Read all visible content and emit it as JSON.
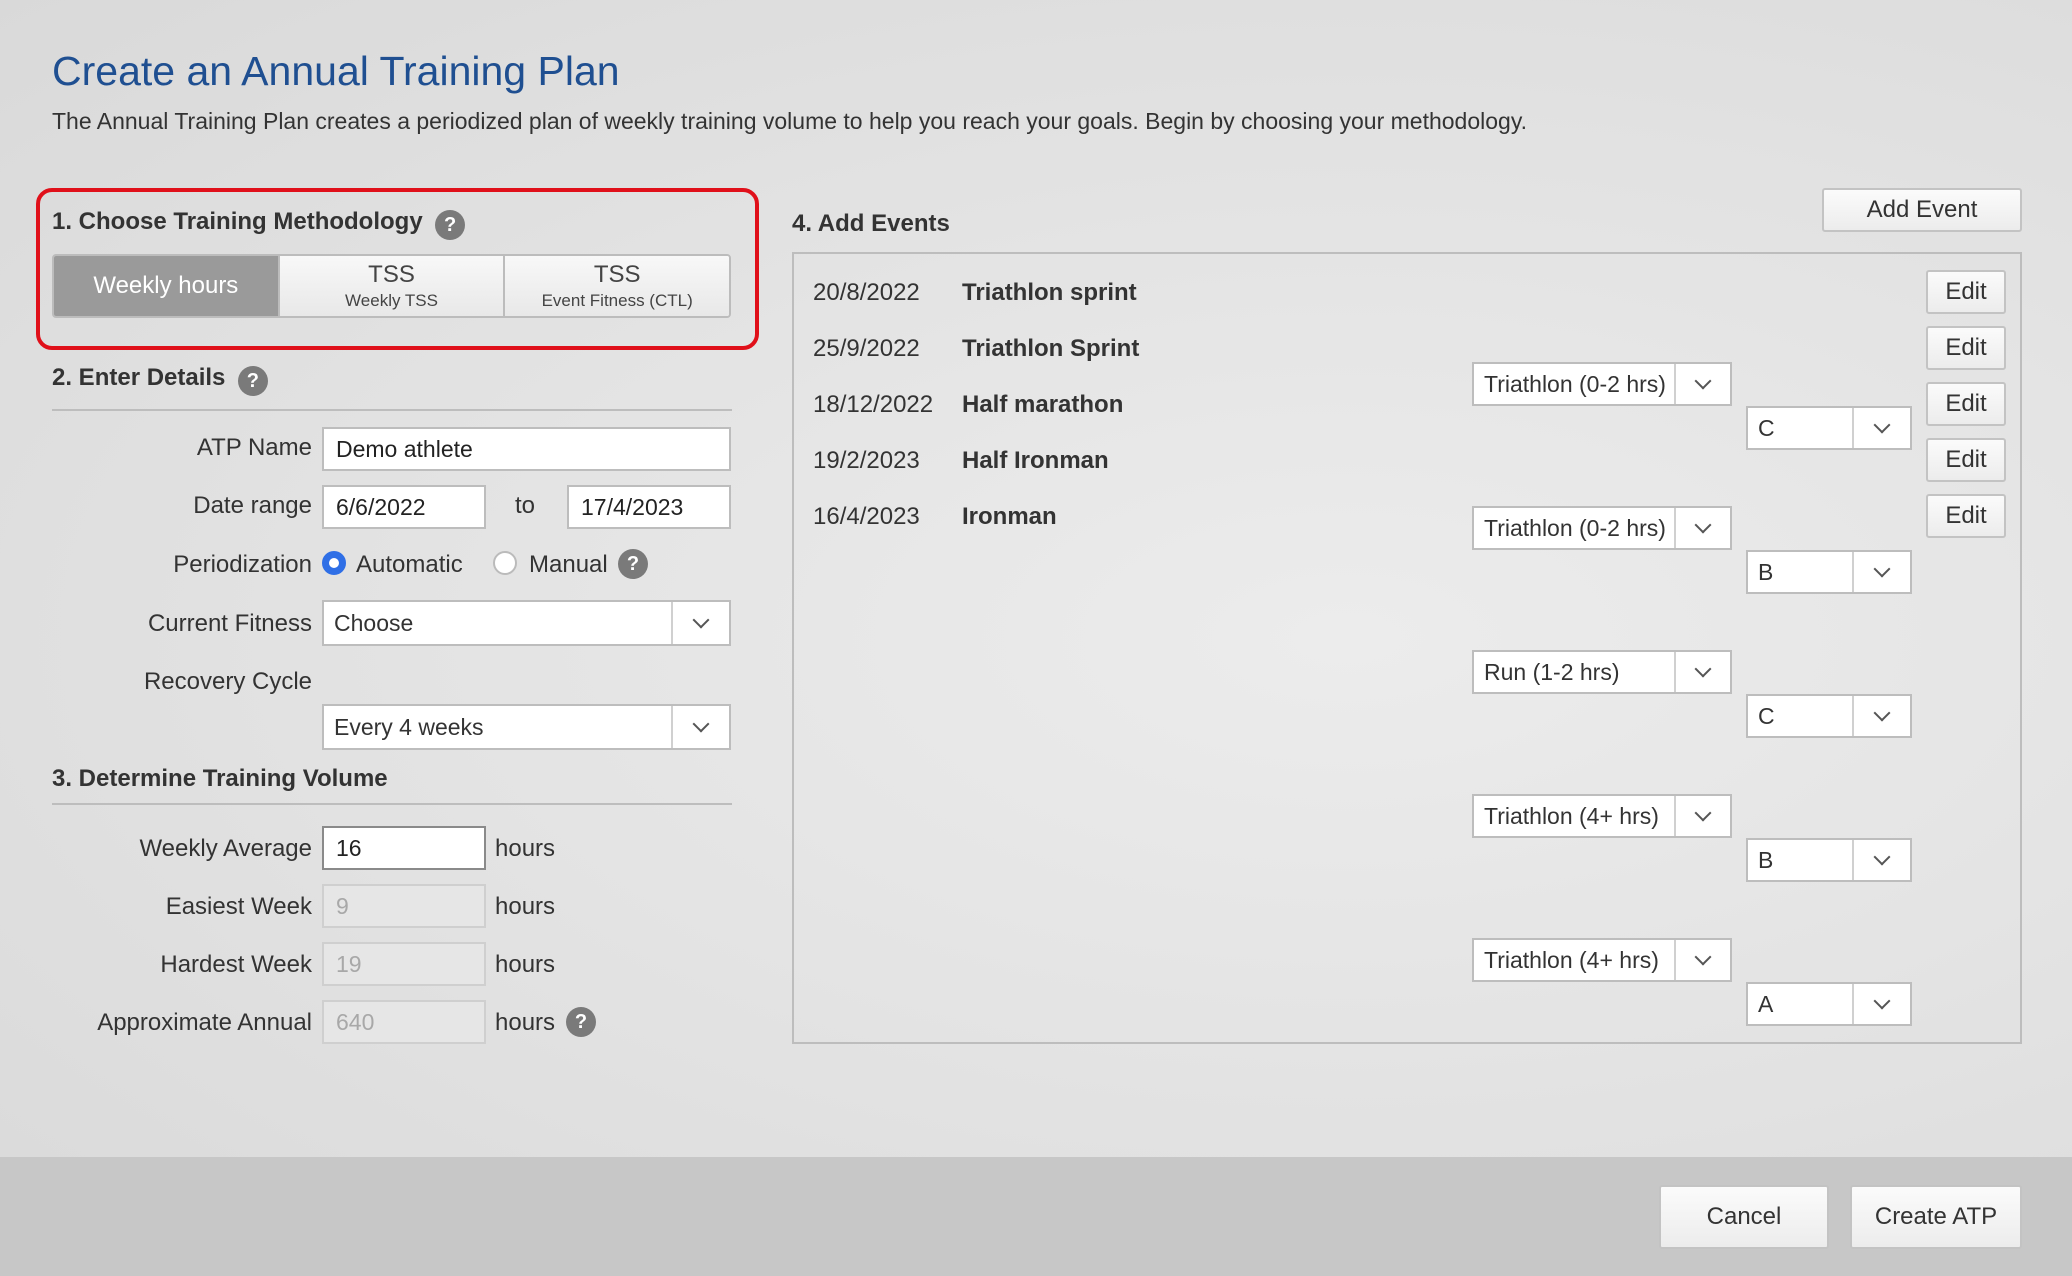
{
  "header": {
    "title": "Create an Annual Training Plan",
    "subtitle": "The Annual Training Plan creates a periodized plan of weekly training volume to help you reach your goals. Begin by choosing your methodology."
  },
  "methodology": {
    "heading": "1. Choose Training Methodology",
    "help": "?",
    "options": [
      {
        "label": "Weekly hours",
        "sub": "",
        "active": true
      },
      {
        "label": "TSS",
        "sub": "Weekly TSS",
        "active": false
      },
      {
        "label": "TSS",
        "sub": "Event Fitness (CTL)",
        "active": false
      }
    ]
  },
  "details": {
    "heading": "2. Enter Details",
    "help": "?",
    "atp_name_label": "ATP Name",
    "atp_name_value": "Demo athlete",
    "date_range_label": "Date range",
    "date_from": "6/6/2022",
    "date_to_label": "to",
    "date_to": "17/4/2023",
    "periodization_label": "Periodization",
    "periodization_automatic": "Automatic",
    "periodization_manual": "Manual",
    "periodization_selected": "Automatic",
    "current_fitness_label": "Current Fitness",
    "current_fitness_value": "Choose",
    "recovery_cycle_label": "Recovery Cycle",
    "recovery_cycle_value": "Every 4 weeks"
  },
  "volume": {
    "heading": "3. Determine Training Volume",
    "weekly_average_label": "Weekly Average",
    "weekly_average_value": "16",
    "easiest_week_label": "Easiest Week",
    "easiest_week_value": "9",
    "hardest_week_label": "Hardest Week",
    "hardest_week_value": "19",
    "approx_annual_label": "Approximate Annual",
    "approx_annual_value": "640",
    "unit": "hours",
    "help": "?"
  },
  "events": {
    "heading": "4. Add Events",
    "add_button": "Add Event",
    "edit_label": "Edit",
    "items": [
      {
        "date": "20/8/2022",
        "name": "Triathlon sprint",
        "type": "Triathlon (0-2 hrs)",
        "priority": "C"
      },
      {
        "date": "25/9/2022",
        "name": "Triathlon Sprint",
        "type": "Triathlon (0-2 hrs)",
        "priority": "B"
      },
      {
        "date": "18/12/2022",
        "name": "Half marathon",
        "type": "Run (1-2 hrs)",
        "priority": "C"
      },
      {
        "date": "19/2/2023",
        "name": "Half Ironman",
        "type": "Triathlon (4+ hrs)",
        "priority": "B"
      },
      {
        "date": "16/4/2023",
        "name": "Ironman",
        "type": "Triathlon (4+ hrs)",
        "priority": "A"
      }
    ]
  },
  "footer": {
    "cancel": "Cancel",
    "create": "Create ATP"
  },
  "colors": {
    "title": "#1f4f91",
    "highlight": "#e0101a",
    "radio_checked": "#2f6fe6",
    "active_segment": "#9a9a9a"
  }
}
